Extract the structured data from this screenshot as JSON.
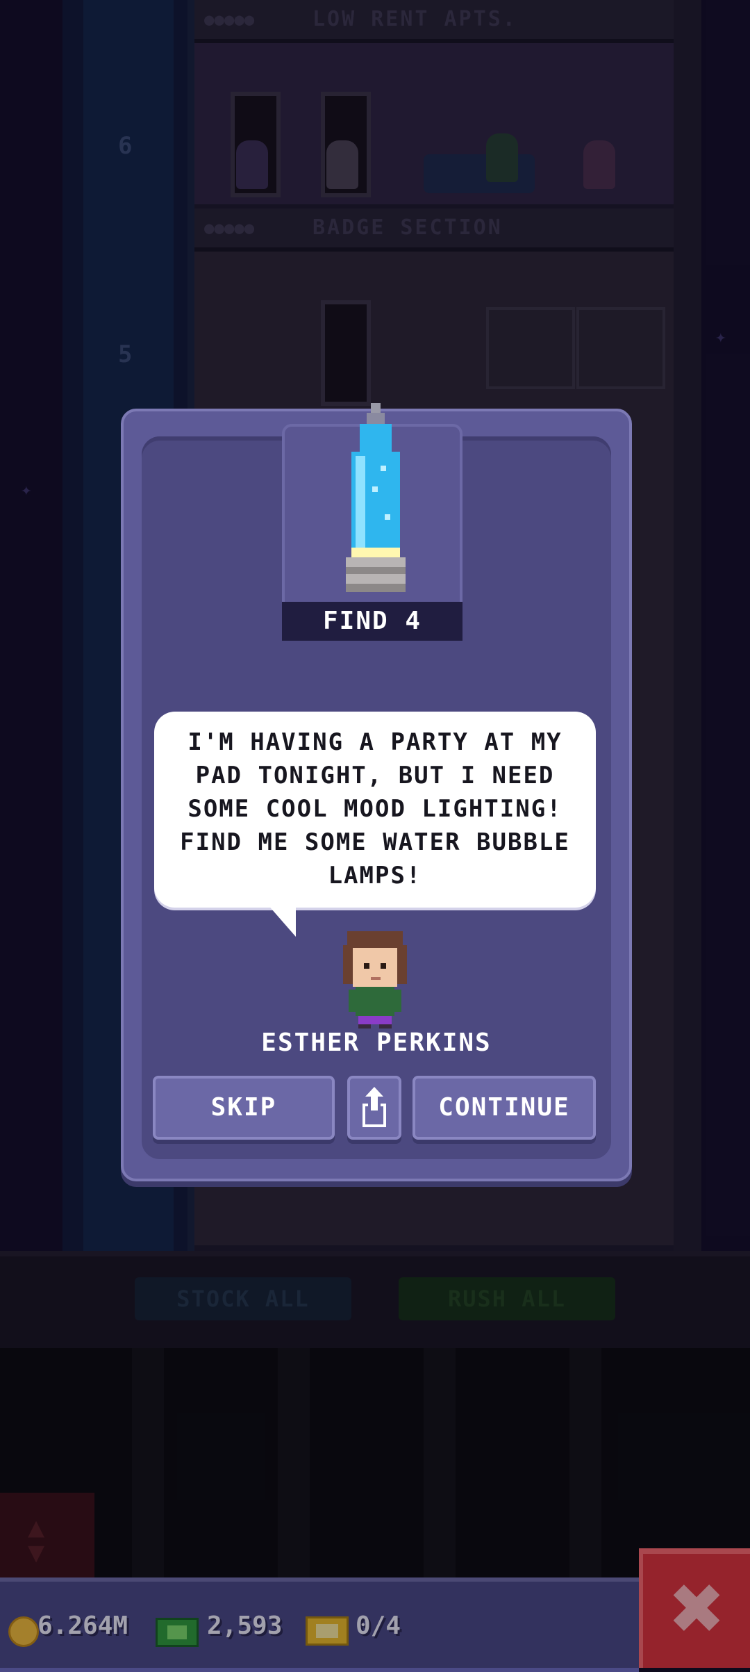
{
  "background": {
    "floors": [
      {
        "title": "LOW RENT APTS.",
        "number": "6"
      },
      {
        "title": "BADGE SECTION",
        "number": "5"
      }
    ],
    "bottom_buttons": {
      "stock_all": "STOCK ALL",
      "rush_all": "RUSH ALL"
    }
  },
  "dialog": {
    "find_label": "FIND 4",
    "item_icon": "water-bubble-lamp",
    "speech": "I'M HAVING A PARTY AT MY PAD TONIGHT, BUT I NEED SOME COOL MOOD LIGHTING! FIND ME SOME WATER BUBBLE LAMPS!",
    "character_name": "ESTHER PERKINS",
    "buttons": {
      "skip": "SKIP",
      "share_icon": "share-icon",
      "continue": "CONTINUE"
    }
  },
  "hud": {
    "coins": "6.264M",
    "bux": "2,593",
    "tickets": "0/4",
    "close_icon": "close-icon"
  },
  "colors": {
    "dialog_bg": "#5d5a97",
    "close_button": "#e0333a",
    "lamp_blue": "#2fb6ee"
  }
}
